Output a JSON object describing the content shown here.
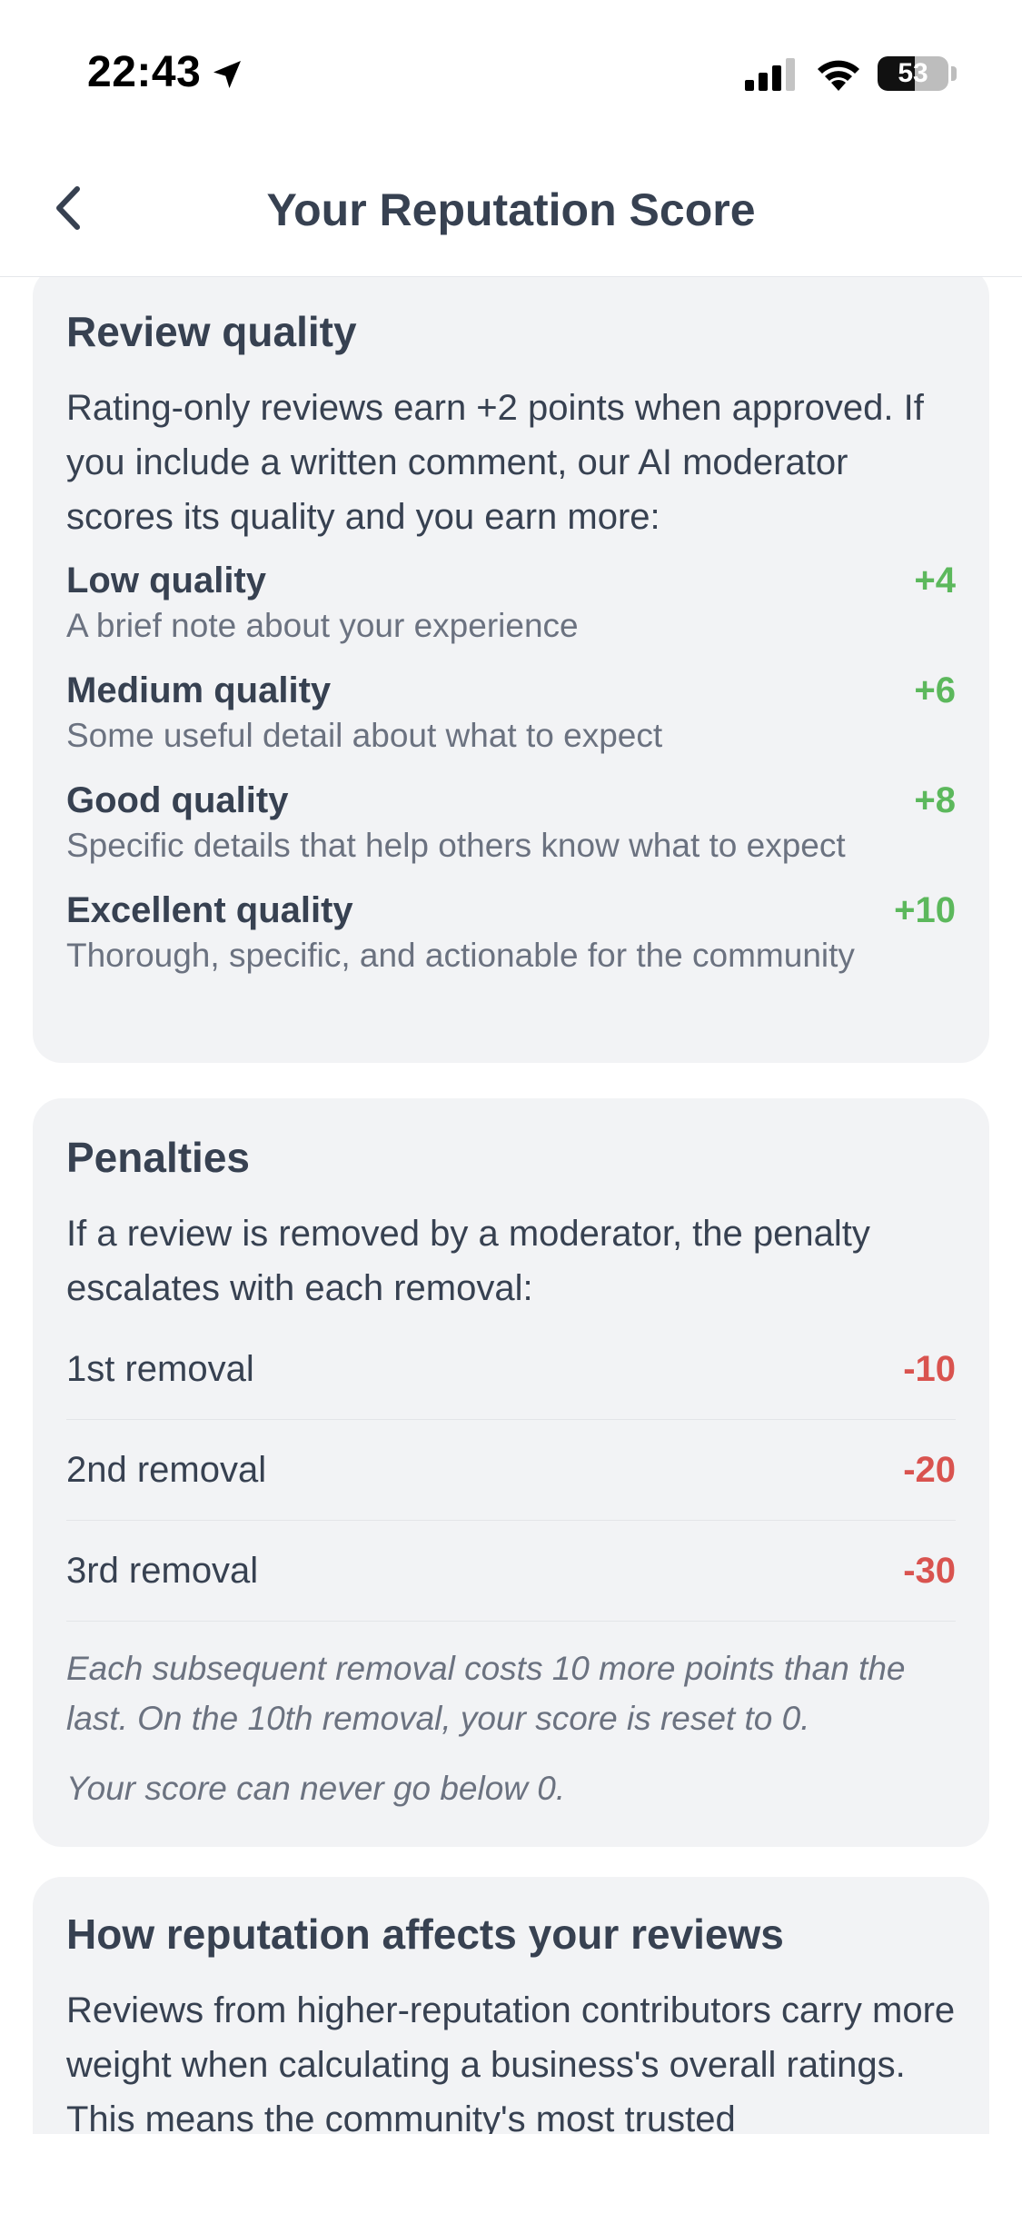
{
  "status_bar": {
    "time": "22:43",
    "battery_level": 53,
    "battery_text": "53",
    "icons": [
      "location-arrow-icon",
      "cellular-signal-icon",
      "wifi-icon",
      "battery-icon"
    ]
  },
  "header": {
    "title": "Your Reputation Score",
    "back_icon": "chevron-left-icon"
  },
  "review_quality": {
    "title": "Review quality",
    "intro": "Rating-only reviews earn +2 points when approved. If you include a written comment, our AI moderator scores its quality and you earn more:",
    "items": [
      {
        "label": "Low quality",
        "points": "+4",
        "description": "A brief note about your experience"
      },
      {
        "label": "Medium quality",
        "points": "+6",
        "description": "Some useful detail about what to expect"
      },
      {
        "label": "Good quality",
        "points": "+8",
        "description": "Specific details that help others know what to expect"
      },
      {
        "label": "Excellent quality",
        "points": "+10",
        "description": "Thorough, specific, and actionable for the community"
      }
    ]
  },
  "penalties": {
    "title": "Penalties",
    "intro": "If a review is removed by a moderator, the penalty escalates with each removal:",
    "items": [
      {
        "label": "1st removal",
        "points": "-10"
      },
      {
        "label": "2nd removal",
        "points": "-20"
      },
      {
        "label": "3rd removal",
        "points": "-30"
      }
    ],
    "note_escalation": "Each subsequent removal costs 10 more points than the last. On the 10th removal, your score is reset to 0.",
    "note_floor": "Your score can never go below 0."
  },
  "reputation_effect": {
    "title": "How reputation affects your reviews",
    "body": "Reviews from higher-reputation contributors carry more weight when calculating a business's overall ratings. This means the community's most trusted"
  },
  "colors": {
    "positive": "#5cb85c",
    "negative": "#d9534f",
    "card_background": "#f2f3f5",
    "text_primary": "#374151",
    "text_secondary": "#6b7280"
  }
}
